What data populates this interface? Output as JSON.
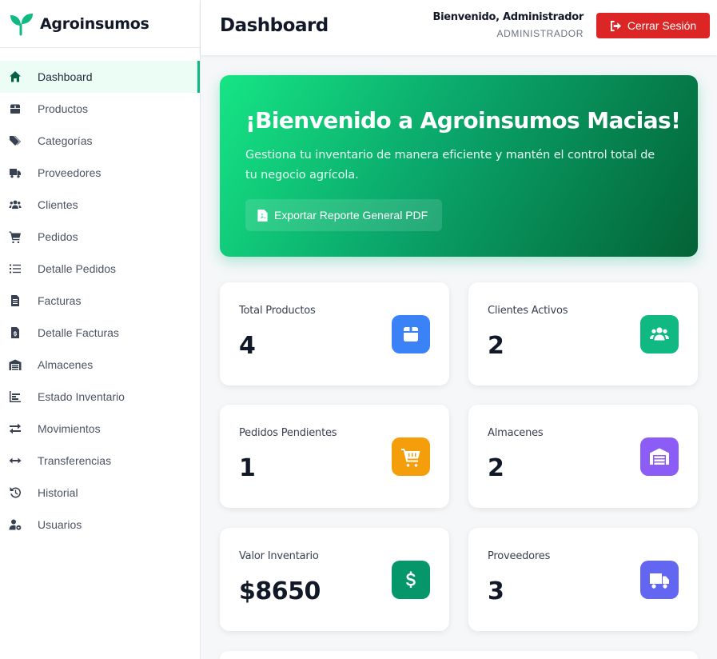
{
  "brand": {
    "name": "Agroinsumos",
    "icon": "seedling-icon",
    "color": "#10b981"
  },
  "sidebar": {
    "active_color": "#10b981",
    "items": [
      {
        "label": "Dashboard",
        "icon": "home-icon",
        "active": true
      },
      {
        "label": "Productos",
        "icon": "box-icon"
      },
      {
        "label": "Categorías",
        "icon": "tags-icon"
      },
      {
        "label": "Proveedores",
        "icon": "truck-icon"
      },
      {
        "label": "Clientes",
        "icon": "users-icon"
      },
      {
        "label": "Pedidos",
        "icon": "cart-icon"
      },
      {
        "label": "Detalle Pedidos",
        "icon": "list-icon"
      },
      {
        "label": "Facturas",
        "icon": "invoice-icon"
      },
      {
        "label": "Detalle Facturas",
        "icon": "invoice-dollar-icon"
      },
      {
        "label": "Almacenes",
        "icon": "warehouse-icon"
      },
      {
        "label": "Estado Inventario",
        "icon": "chart-bar-icon"
      },
      {
        "label": "Movimientos",
        "icon": "exchange-icon"
      },
      {
        "label": "Transferencias",
        "icon": "arrows-h-icon"
      },
      {
        "label": "Historial",
        "icon": "history-icon"
      },
      {
        "label": "Usuarios",
        "icon": "user-cog-icon"
      }
    ]
  },
  "header": {
    "title": "Dashboard",
    "user_greeting": "Bienvenido, Administrador",
    "user_role": "ADMINISTRADOR",
    "logout_label": "Cerrar Sesión",
    "logout_color": "#dc2626"
  },
  "hero": {
    "title": "¡Bienvenido a Agroinsumos Macias!",
    "subtitle": "Gestiona tu inventario de manera eficiente y mantén el control total de tu negocio agrícola.",
    "export_label": "Exportar Reporte General PDF",
    "gradient": [
      "#16e585",
      "#036236"
    ]
  },
  "stats": [
    {
      "label": "Total Productos",
      "value": "4",
      "icon": "box-icon",
      "color": "#3b82f6"
    },
    {
      "label": "Clientes Activos",
      "value": "2",
      "icon": "users-icon",
      "color": "#10b981"
    },
    {
      "label": "Pedidos Pendientes",
      "value": "1",
      "icon": "cart-icon",
      "color": "#f59e0b"
    },
    {
      "label": "Almacenes",
      "value": "2",
      "icon": "warehouse-icon",
      "color": "#8b5cf6"
    },
    {
      "label": "Valor Inventario",
      "value": "$8650",
      "icon": "dollar-icon",
      "color": "#059669"
    },
    {
      "label": "Proveedores",
      "value": "3",
      "icon": "truck-icon",
      "color": "#6366f1"
    }
  ]
}
